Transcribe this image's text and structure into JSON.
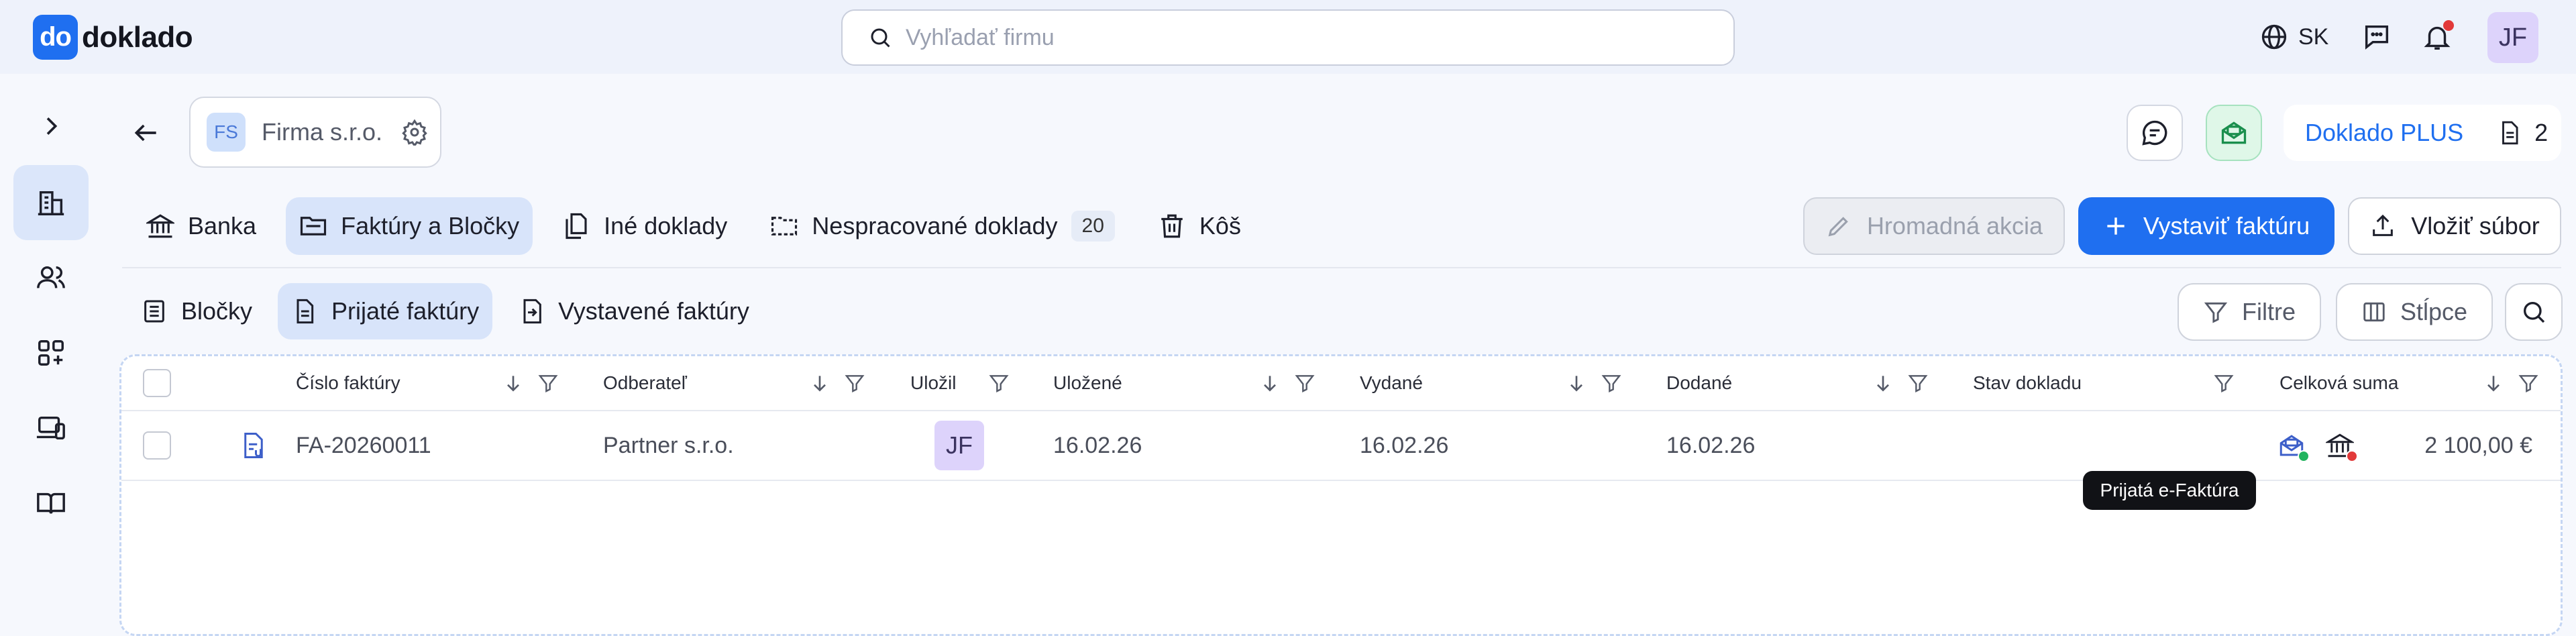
{
  "app": {
    "logo_mark": "do",
    "logo_text": "doklado"
  },
  "search": {
    "placeholder": "Vyhľadať firmu"
  },
  "top": {
    "language": "SK",
    "user_initials": "JF"
  },
  "company": {
    "badge": "FS",
    "name": "Firma s.r.o."
  },
  "header_right": {
    "plan_label": "Doklado PLUS",
    "doc_count": "2"
  },
  "tabs_primary": [
    {
      "label": "Banka",
      "icon": "bank-icon"
    },
    {
      "label": "Faktúry a Bločky",
      "icon": "folder-icon",
      "active": true
    },
    {
      "label": "Iné doklady",
      "icon": "documents-icon"
    },
    {
      "label": "Nespracované doklady",
      "icon": "dashed-folder-icon",
      "count": "20"
    },
    {
      "label": "Kôš",
      "icon": "trash-icon"
    }
  ],
  "actions": {
    "mass_action": "Hromadná akcia",
    "issue_invoice": "Vystaviť faktúru",
    "upload_file": "Vložiť súbor"
  },
  "tabs_secondary": [
    {
      "label": "Bločky",
      "icon": "receipt-icon"
    },
    {
      "label": "Prijaté faktúry",
      "icon": "invoice-icon",
      "active": true
    },
    {
      "label": "Vystavené faktúry",
      "icon": "export-icon"
    }
  ],
  "tools": {
    "filter": "Filtre",
    "columns": "Stĺpce"
  },
  "table": {
    "columns": [
      "Číslo faktúry",
      "Odberateľ",
      "Uložil",
      "Uložené",
      "Vydané",
      "Dodané",
      "Stav dokladu",
      "Celková suma"
    ],
    "rows": [
      {
        "invoice_no": "FA-20260011",
        "customer": "Partner s.r.o.",
        "saved_by": "JF",
        "saved": "16.02.26",
        "issued": "16.02.26",
        "delivered": "16.02.26",
        "total": "2 100,00 €"
      }
    ]
  },
  "tooltip": "Prijatá e-Faktúra",
  "colors": {
    "accent": "#1f6ff0",
    "active_tab": "#d8e4fa",
    "avatar": "#ddd3fb",
    "alert_red": "#e23a3a",
    "status_green": "#22b35e"
  }
}
